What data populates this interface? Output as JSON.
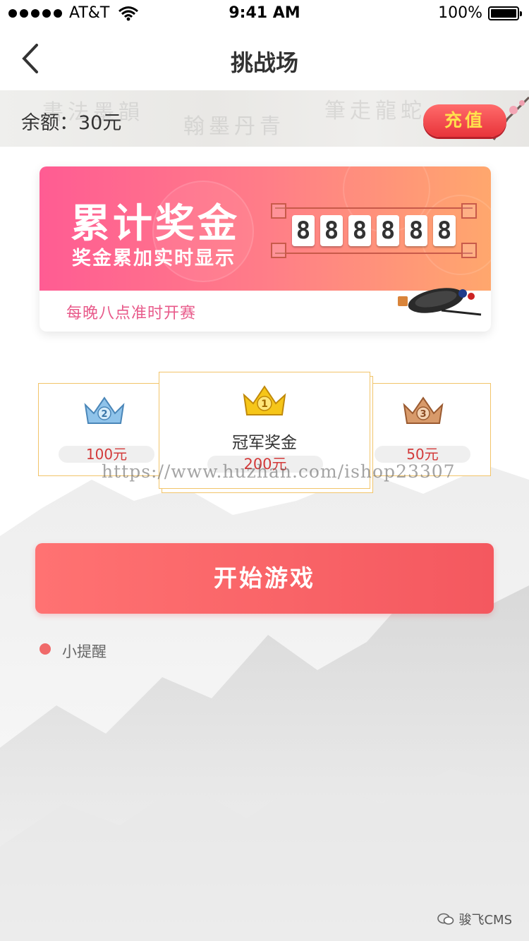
{
  "status_bar": {
    "carrier": "AT&T",
    "time": "9:41 AM",
    "battery": "100%"
  },
  "nav": {
    "title": "挑战场"
  },
  "balance": {
    "text": "余额：30元",
    "recharge_label": "充值"
  },
  "jackpot": {
    "title": "累计奖金",
    "subtitle": "奖金累加实时显示",
    "digits": [
      "8",
      "8",
      "8",
      "8",
      "8",
      "8"
    ],
    "note": "每晚八点准时开赛"
  },
  "prizes": {
    "second": {
      "rank": "2",
      "amount": "100元"
    },
    "first": {
      "rank": "1",
      "label": "冠军奖金",
      "amount": "200元"
    },
    "third": {
      "rank": "3",
      "amount": "50元"
    }
  },
  "watermark": "https://www.huzhan.com/ishop23307",
  "start_button": "开始游戏",
  "tip": "小提醒",
  "footer": "骏飞CMS",
  "colors": {
    "accent": "#f4585f",
    "gold_border": "#f2c46a",
    "pink": "#ff5c93",
    "orange": "#ffa76d"
  }
}
